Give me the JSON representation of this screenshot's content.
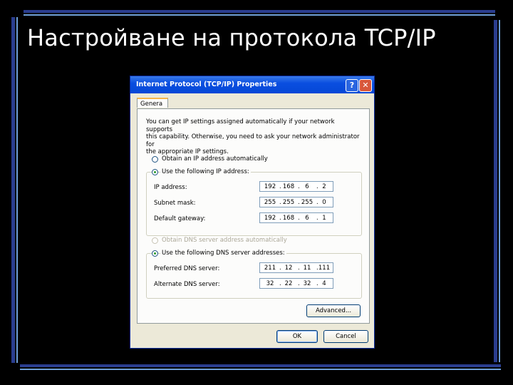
{
  "slide": {
    "title": "Настройване на протокола TCP/IP"
  },
  "dialog": {
    "title": "Internet Protocol (TCP/IP) Properties",
    "help_label": "?",
    "close_label": "✕",
    "tab_label": "Genera",
    "description": "You can get IP settings assigned automatically if your network supports\nthis capability. Otherwise, you need to ask your network administrator for\nthe appropriate IP settings.",
    "ip_section": {
      "option_auto": "Obtain an IP address automatically",
      "option_manual": "Use the following IP address:",
      "selected": "manual",
      "fields": [
        {
          "label": "IP address:",
          "octets": [
            "192",
            "168",
            "6",
            "2"
          ]
        },
        {
          "label": "Subnet mask:",
          "octets": [
            "255",
            "255",
            "255",
            "0"
          ]
        },
        {
          "label": "Default gateway:",
          "octets": [
            "192",
            "168",
            "6",
            "1"
          ]
        }
      ]
    },
    "dns_section": {
      "option_auto": "Obtain DNS server address automatically",
      "option_manual": "Use the following DNS server addresses:",
      "selected": "manual",
      "auto_disabled": true,
      "fields": [
        {
          "label": "Preferred DNS server:",
          "octets": [
            "211",
            "12",
            "11",
            "111"
          ]
        },
        {
          "label": "Alternate DNS server:",
          "octets": [
            "32",
            "22",
            "32",
            "4"
          ]
        }
      ]
    },
    "advanced_label": "Advanced...",
    "ok_label": "OK",
    "cancel_label": "Cancel"
  },
  "colors": {
    "titlebar": "#0548d6",
    "dialog_bg": "#ece9d8",
    "frame_accent": "#2a3d8f"
  }
}
